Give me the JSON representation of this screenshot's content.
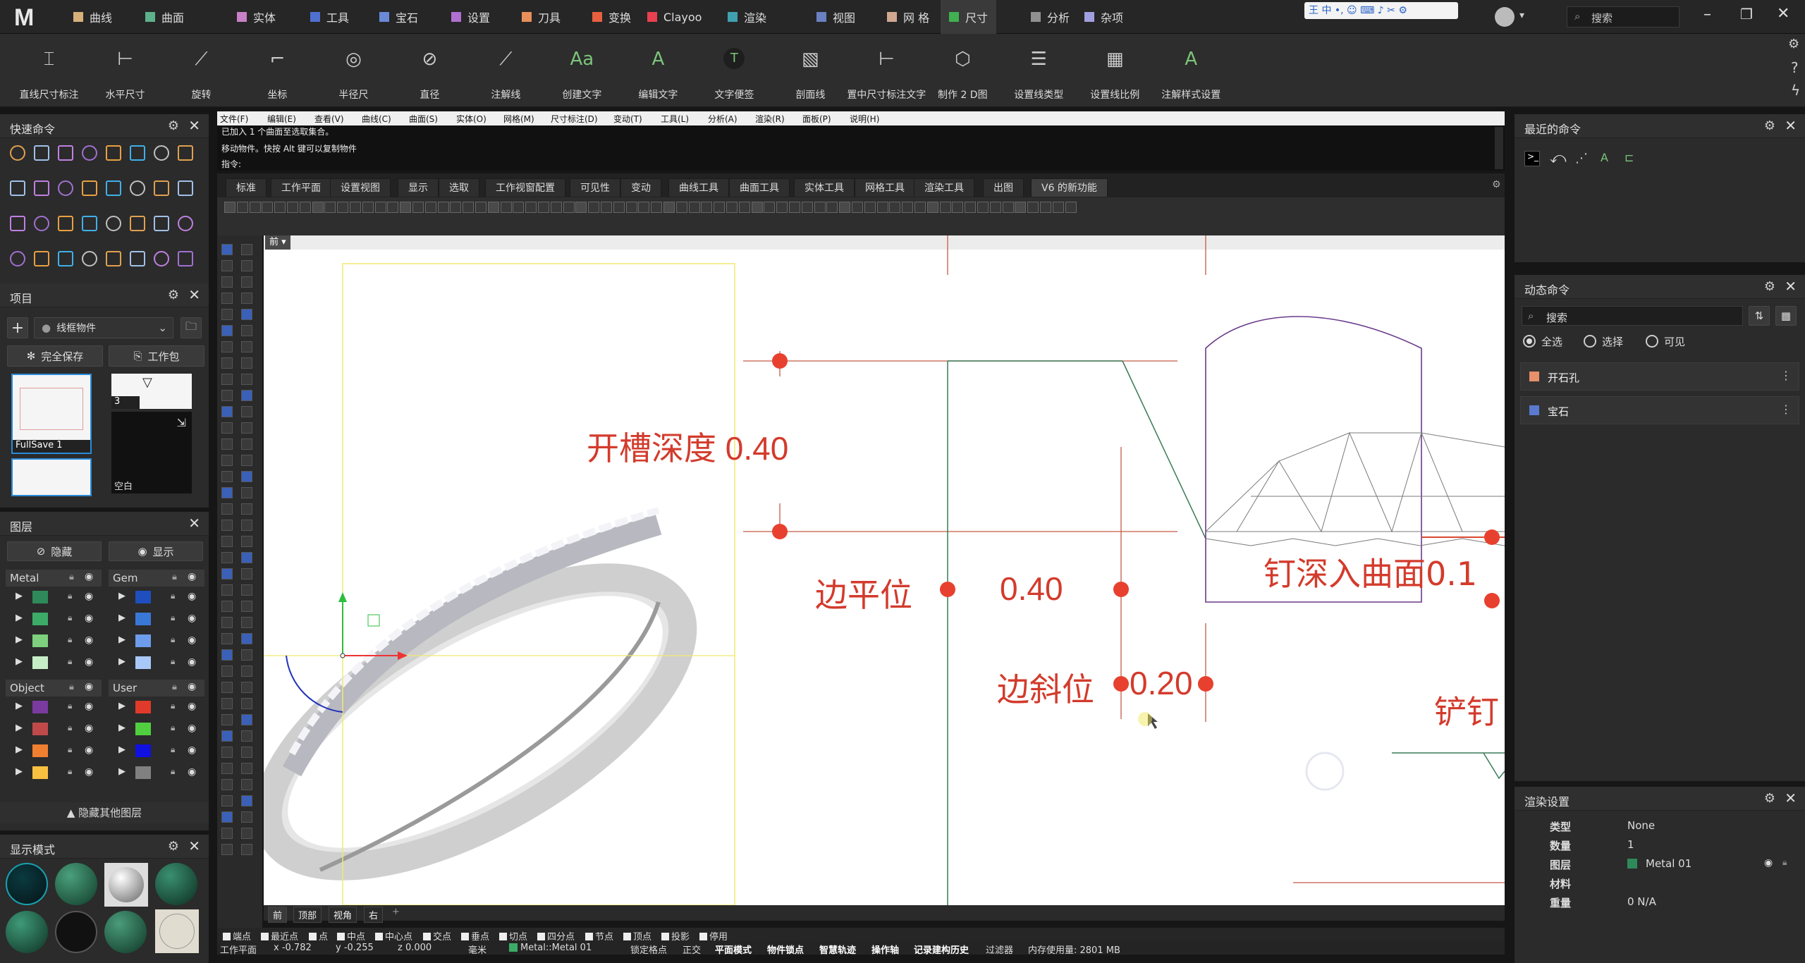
{
  "app": {
    "logo": "M",
    "search_placeholder": "搜索"
  },
  "menu_tabs": [
    {
      "label": "曲线",
      "color": "#d8b07a"
    },
    {
      "label": "曲面",
      "color": "#5db08c"
    },
    {
      "label": "实体",
      "color": "#c880c8"
    },
    {
      "label": "工具",
      "color": "#5070d0"
    },
    {
      "label": "宝石",
      "color": "#6a8ad8"
    },
    {
      "label": "设置",
      "color": "#b070d0"
    },
    {
      "label": "刀具",
      "color": "#e8905a"
    },
    {
      "label": "变换",
      "color": "#e86040"
    },
    {
      "label": "Clayoo",
      "color": "#e84050"
    },
    {
      "label": "渲染",
      "color": "#40a0b0"
    },
    {
      "label": "视图",
      "color": "#6a80c0"
    },
    {
      "label": "网 格",
      "color": "#d0a890"
    },
    {
      "label": "尺寸",
      "color": "#40b050"
    },
    {
      "label": "分析",
      "color": "#909090"
    },
    {
      "label": "杂项",
      "color": "#a0a0e0"
    }
  ],
  "ribbon": [
    {
      "label": "直线尺寸标注",
      "icon": "linear-dimension-icon"
    },
    {
      "label": "水平尺寸",
      "icon": "horizontal-dimension-icon"
    },
    {
      "label": "旋转",
      "icon": "rotated-dimension-icon"
    },
    {
      "label": "坐标",
      "icon": "ordinate-icon"
    },
    {
      "label": "半径尺",
      "icon": "radius-icon"
    },
    {
      "label": "直径",
      "icon": "diameter-icon"
    },
    {
      "label": "注解线",
      "icon": "leader-icon"
    },
    {
      "label": "创建文字",
      "icon": "create-text-icon",
      "glyph": "Aa"
    },
    {
      "label": "编辑文字",
      "icon": "edit-text-icon",
      "glyph": "A"
    },
    {
      "label": "文字便签",
      "icon": "text-dot-icon",
      "glyph": "T"
    },
    {
      "label": "剖面线",
      "icon": "hatch-icon"
    },
    {
      "label": "置中尺寸标注文字",
      "icon": "center-dimension-text-icon"
    },
    {
      "label": "制作 2 D图",
      "icon": "make-2d-icon"
    },
    {
      "label": "设置线类型",
      "icon": "linetype-icon"
    },
    {
      "label": "设置线比例",
      "icon": "linetype-scale-icon"
    },
    {
      "label": "注解样式设置",
      "icon": "annotation-style-icon",
      "glyph": "A"
    }
  ],
  "quick_panel": {
    "title": "快速命令"
  },
  "project_panel": {
    "title": "项目",
    "dropdown": "线框物件",
    "save_full": "完全保存",
    "save_package": "工作包",
    "thumbs": [
      {
        "label": "FullSave 1"
      },
      {
        "label": "3"
      },
      {
        "label": "空白"
      }
    ]
  },
  "layers_panel": {
    "title": "图层",
    "hide": "隐藏",
    "show": "显示",
    "hide_other": "隐藏其他图层",
    "groups": [
      {
        "name": "Metal",
        "colors": [
          "#2e8a5a",
          "#3cab68",
          "#7ed07e",
          "#c7edc7"
        ]
      },
      {
        "name": "Gem",
        "colors": [
          "#1f4fbf",
          "#3a78d8",
          "#6e9cec",
          "#a8c8f8"
        ]
      },
      {
        "name": "Object",
        "colors": [
          "#7a3aa0",
          "#c04a4a",
          "#f08030",
          "#f8c040"
        ]
      },
      {
        "name": "User",
        "colors": [
          "#e03a2a",
          "#50d040",
          "#1010e0",
          "#808080"
        ]
      }
    ]
  },
  "display_panel": {
    "title": "显示模式"
  },
  "rhino_menu": [
    "文件(F)",
    "编辑(E)",
    "查看(V)",
    "曲线(C)",
    "曲面(S)",
    "实体(O)",
    "网格(M)",
    "尺寸标注(D)",
    "变动(T)",
    "工具(L)",
    "分析(A)",
    "渲染(R)",
    "面板(P)",
    "说明(H)"
  ],
  "command_lines": [
    "已加入 1 个曲面至选取集合。",
    "移动物件。快按 Alt 键可以复制物件"
  ],
  "command_prompt": "指令:",
  "toolbar_tabs": [
    "标准",
    "工作平面",
    "设置视图",
    "显示",
    "选取",
    "工作视窗配置",
    "可见性",
    "变动",
    "曲线工具",
    "曲面工具",
    "实体工具",
    "网格工具",
    "渲染工具",
    "出图",
    "V6 的新功能"
  ],
  "viewport": {
    "name": "前",
    "bottom_tabs": [
      "前",
      "顶部",
      "视角",
      "右"
    ],
    "annotations": {
      "slot_depth": "开槽深度 0.40",
      "edge_flat": "边平位",
      "edge_flat_value": "0.40",
      "edge_bevel": "边斜位",
      "edge_bevel_value": "0.20",
      "prong_depth": "钉深入曲面0.1",
      "prong_cut": "铲钉"
    }
  },
  "osnaps": [
    "端点",
    "最近点",
    "点",
    "中点",
    "中心点",
    "交点",
    "垂点",
    "切点",
    "四分点",
    "节点",
    "顶点",
    "投影",
    "停用"
  ],
  "status": {
    "plane": "工作平面",
    "x": "x -0.782",
    "y": "y -0.255",
    "z": "z 0.000",
    "unit": "毫米",
    "layer": "Metal::Metal 01",
    "toggles": [
      "锁定格点",
      "正交",
      "平面模式",
      "物件锁点",
      "智慧轨迹",
      "操作轴",
      "记录建构历史",
      "过滤器"
    ],
    "memory": "内存使用量: 2801 MB"
  },
  "recent_panel": {
    "title": "最近的命令"
  },
  "dynamic_panel": {
    "title": "动态命令",
    "search_placeholder": "搜索",
    "radios": [
      "全选",
      "选择",
      "可见"
    ],
    "items": [
      {
        "label": "开石孔",
        "color": "#e8906a"
      },
      {
        "label": "宝石",
        "color": "#5a7ad0"
      }
    ]
  },
  "render_panel": {
    "title": "渲染设置",
    "rows": [
      {
        "key": "类型",
        "value": "None"
      },
      {
        "key": "数量",
        "value": "1"
      },
      {
        "key": "图层",
        "value": "Metal 01"
      },
      {
        "key": "材料",
        "value": ""
      },
      {
        "key": "重量",
        "value": "0 N/A"
      }
    ]
  }
}
